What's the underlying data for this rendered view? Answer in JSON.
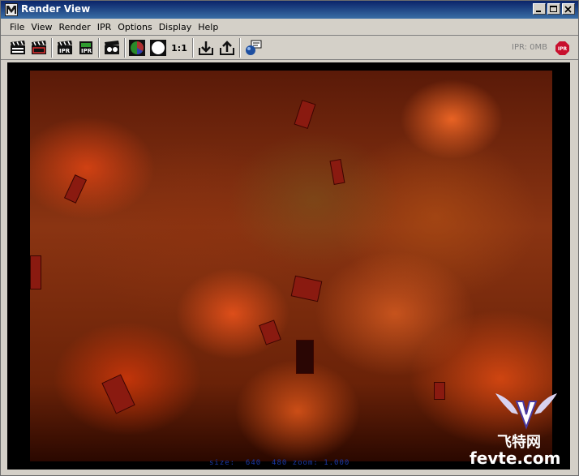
{
  "window": {
    "title": "Render View"
  },
  "menu": [
    "File",
    "View",
    "Render",
    "IPR",
    "Options",
    "Display",
    "Help"
  ],
  "toolbar": {
    "buttons": [
      {
        "name": "redo-previous-render-icon"
      },
      {
        "name": "render-region-icon"
      },
      {
        "name": "ipr-render-icon"
      },
      {
        "name": "ipr-refresh-icon"
      },
      {
        "name": "snapshot-icon"
      },
      {
        "name": "rgb-channel-icon"
      },
      {
        "name": "alpha-channel-icon"
      },
      {
        "name": "real-size-button",
        "label": "1:1"
      },
      {
        "name": "keep-image-icon"
      },
      {
        "name": "remove-image-icon"
      },
      {
        "name": "render-info-icon"
      }
    ],
    "ipr_status": "IPR: 0MB",
    "ipr_stop_label": "IPR"
  },
  "render": {
    "status": "size:  640  480 zoom: 1.000"
  },
  "watermark": {
    "chinese": "飞特网",
    "url": "fevte.com"
  }
}
